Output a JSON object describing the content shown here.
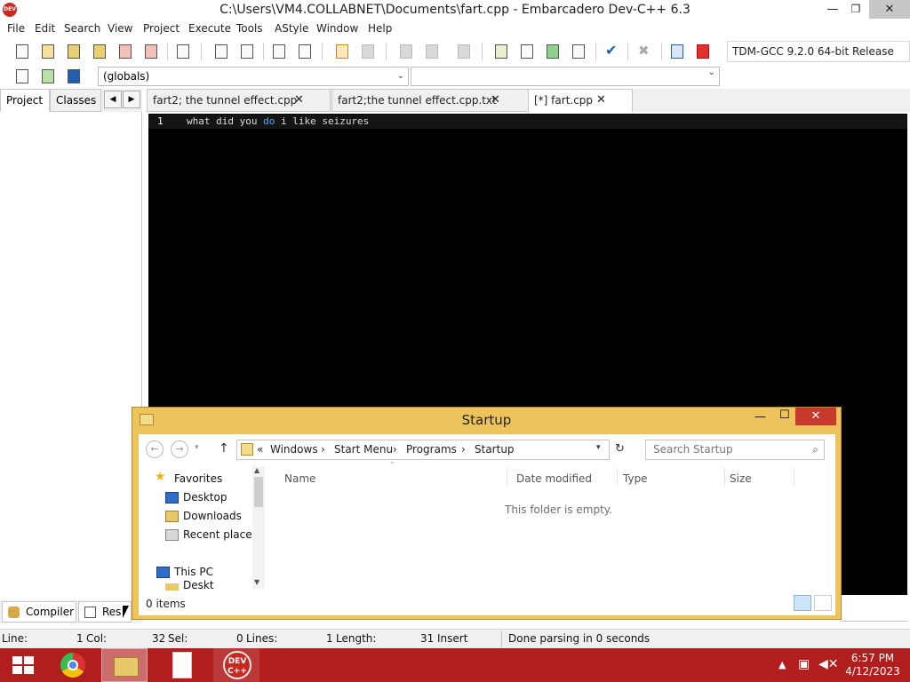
{
  "window": {
    "title": "C:\\Users\\VM4.COLLABNET\\Documents\\fart.cpp - Embarcadero Dev-C++ 6.3",
    "app_icon_text": "DEV C++",
    "minimize": "—",
    "restore": "❐",
    "close": "✕"
  },
  "menu": [
    "File",
    "Edit",
    "Search",
    "View",
    "Project",
    "Execute",
    "Tools",
    "AStyle",
    "Window",
    "Help"
  ],
  "toolbar": {
    "compiler": "TDM-GCC 9.2.0 64-bit Release",
    "globals_combo": "(globals)",
    "members_combo": ""
  },
  "left_panel": {
    "tabs": [
      "Project",
      "Classes"
    ],
    "prev_arrow": "◀",
    "next_arrow": "▶"
  },
  "editor": {
    "tabs": [
      {
        "label": "fart2; the tunnel effect.cpp",
        "close": "✕"
      },
      {
        "label": "fart2;the tunnel effect.cpp.txt",
        "close": "✕"
      },
      {
        "label": "[*] fart.cpp",
        "close": "✕"
      }
    ],
    "lines": [
      {
        "number": "1",
        "before": "what did you ",
        "keyword": "do",
        "after": " i like seizures"
      }
    ]
  },
  "bottom_tabs": [
    "Compiler",
    "Res"
  ],
  "status": {
    "line_label": "Line:",
    "line_value": "1",
    "col_label": "Col:",
    "col_value": "32",
    "sel_label": "Sel:",
    "sel_value": "0",
    "lines_label": "Lines:",
    "lines_value": "1",
    "length_label": "Length:",
    "length_value": "31",
    "mode": "Insert",
    "message": "Done parsing in 0 seconds"
  },
  "explorer": {
    "title": "Startup",
    "minimize": "—",
    "maximize": "☐",
    "close": "✕",
    "back": "←",
    "forward": "→",
    "recent": "▾",
    "up": "↑",
    "breadcrumb": [
      "«",
      "Windows",
      "›",
      "Start Menu",
      "›",
      "Programs",
      "›",
      "Startup"
    ],
    "dropdown": "▾",
    "refresh": "↻",
    "search_placeholder": "Search Startup",
    "search_icon": "⌕",
    "nav": {
      "favorites": "Favorites",
      "desktop": "Desktop",
      "downloads": "Downloads",
      "recent": "Recent places",
      "this_pc": "This PC",
      "partial": "Deskt"
    },
    "columns": [
      "Name",
      "Date modified",
      "Type",
      "Size"
    ],
    "sort_arrow": "˄",
    "empty_message": "This folder is empty.",
    "item_count": "0 items"
  },
  "taskbar": {
    "devcpp_text": "DEV C++",
    "clock_time": "6:57 PM",
    "clock_date": "4/12/2023",
    "tray_arrow": "▲",
    "accent": "#b21e1e"
  }
}
